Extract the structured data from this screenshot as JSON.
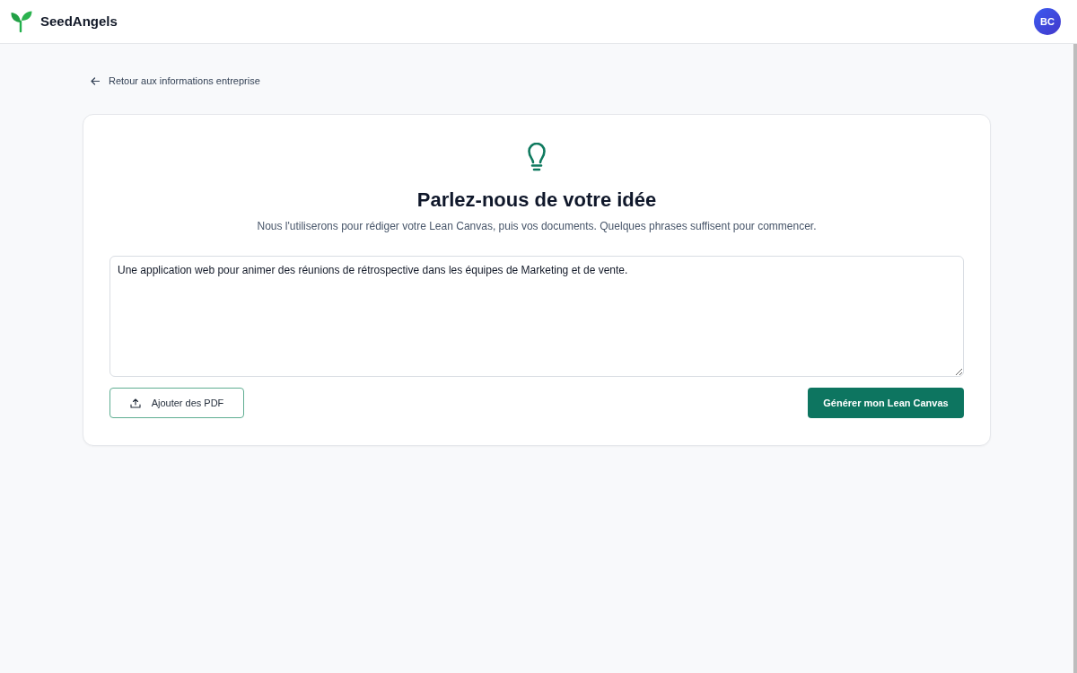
{
  "header": {
    "brand": "SeedAngels",
    "avatar_initials": "BC"
  },
  "back_link": {
    "label": "Retour aux informations entreprise"
  },
  "card": {
    "title": "Parlez-nous de votre idée",
    "subtitle": "Nous l'utiliserons pour rédiger votre Lean Canvas, puis vos documents. Quelques phrases suffisent pour commencer.",
    "idea_field": {
      "value": "Une application web pour animer des réunions de rétrospective dans les équipes de Marketing et de vente."
    },
    "upload_button": {
      "label": "Ajouter des PDF"
    },
    "submit_button": {
      "label": "Générer mon Lean Canvas"
    }
  }
}
